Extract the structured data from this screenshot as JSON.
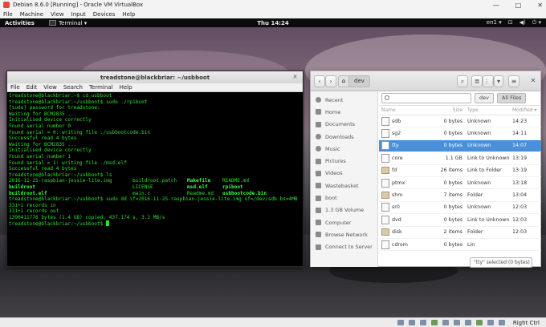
{
  "vbox": {
    "title": "Debian 8.6.0 [Running] - Oracle VM VirtualBox",
    "menu": [
      "File",
      "Machine",
      "View",
      "Input",
      "Devices",
      "Help"
    ],
    "minimize": "—",
    "maximize": "□",
    "close": "✕",
    "host_key": "Right Ctrl"
  },
  "topbar": {
    "activities": "Activities",
    "app": "Terminal ▾",
    "clock": "Thu 14:24",
    "keyboard": "en1 ▾",
    "network": "⊡",
    "volume": "◀)",
    "power": "⏻ ▾"
  },
  "terminal": {
    "title": "treadstone@blackbriar: ~/usbboot",
    "close": "✕",
    "menu": [
      "File",
      "Edit",
      "View",
      "Search",
      "Terminal",
      "Help"
    ],
    "lines": [
      "treadstone@blackbriar:~$ cd usbboot",
      "treadstone@blackbriar:~/usbboot$ sudo ./rpiboot",
      "[sudo] password for treadstone:",
      "Waiting for BCM2835 ...",
      "Initialised device correctly",
      "Found serial number 0",
      "Found serial = 0: writing file ./usbbootcode.bin",
      "Successful read 4 bytes",
      "Waiting for BCM2835 ...",
      "Initialised device correctly",
      "Found serial number 1",
      "Found serial = 1: writing file ./msd.elf",
      "Successful read 4 bytes",
      "treadstone@blackbriar:~/usbboot$ ls"
    ],
    "ls_row1": [
      "2016-11-25-raspbian-jessie-lite.img",
      "buildroot.patch",
      "Makefile",
      "README.md"
    ],
    "ls_row2": [
      "buildroot",
      "LICENSE",
      "msd.elf",
      "rpiboot"
    ],
    "ls_row3": [
      "buildroot.elf",
      "main.c",
      "Readme.md",
      "usbbootcode.bin"
    ],
    "lines2": [
      "treadstone@blackbriar:~/usbboot$ sudo dd if=2016-11-25-raspbian-jessie-lite.img of=/dev/sdb bs=4MB",
      "331+1 records in",
      "331+1 records out",
      "1390411776 bytes (1.4 GB) copied, 437.174 s, 3.2 MB/s"
    ],
    "prompt": "treadstone@blackbriar:~/usbboot$ "
  },
  "files": {
    "back": "‹",
    "forward": "›",
    "home": "⌂",
    "crumb": "dev",
    "search_btn": "⌕",
    "list_btn": "≣",
    "grid_btn": "⋮⋮",
    "sort_btn": "▾",
    "menu_btn": "≡",
    "close": "✕",
    "sidebar": [
      "Recent",
      "Home",
      "Documents",
      "Downloads",
      "Music",
      "Pictures",
      "Videos",
      "Wastebasket",
      "boot",
      "1.3 GB Volume",
      "Computer",
      "Browse Network",
      "Connect to Server"
    ],
    "search_value": "",
    "filter_dev": "dev",
    "filter_all": "All Files",
    "columns": {
      "name": "Name",
      "size": "Size",
      "type": "Type",
      "modified": "Modified ▾"
    },
    "rows": [
      {
        "name": "sdb",
        "size": "0 bytes",
        "type": "Unknown",
        "modified": "14:23"
      },
      {
        "name": "sg2",
        "size": "0 bytes",
        "type": "Unknown",
        "modified": "14:11"
      },
      {
        "name": "tty",
        "size": "0 bytes",
        "type": "Unknown",
        "modified": "14:07"
      },
      {
        "name": "core",
        "size": "1.1 GB",
        "type": "Link to Unknown",
        "modified": "13:19"
      },
      {
        "name": "fd",
        "size": "26 items",
        "type": "Link to Folder",
        "modified": "13:19"
      },
      {
        "name": "ptmx",
        "size": "0 bytes",
        "type": "Unknown",
        "modified": "13:18"
      },
      {
        "name": "shm",
        "size": "7 items",
        "type": "Folder",
        "modified": "13:04"
      },
      {
        "name": "sr0",
        "size": "0 bytes",
        "type": "Unknown",
        "modified": "12:03"
      },
      {
        "name": "dvd",
        "size": "0 bytes",
        "type": "Link to Unknown",
        "modified": "12:03"
      },
      {
        "name": "disk",
        "size": "2 items",
        "type": "Folder",
        "modified": "12:03"
      },
      {
        "name": "cdrom",
        "size": "0 bytes",
        "type": "Lin",
        "modified": ""
      }
    ],
    "status": "\"tty\" selected (0 bytes)"
  }
}
